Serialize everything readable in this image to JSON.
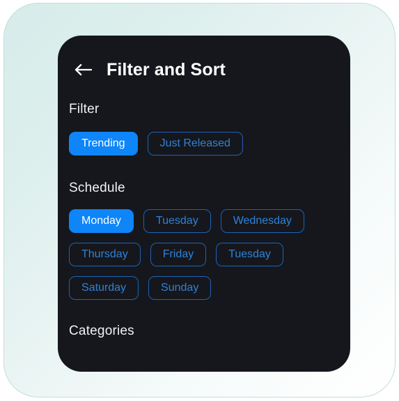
{
  "screen": {
    "background_gradient_from": "#d7ecea",
    "background_gradient_to": "#ffffff",
    "card_background": "#15171c",
    "accent_color": "#0e85f8",
    "outline_border_color": "#1c63b8",
    "outline_text_color": "#2f82d8"
  },
  "header": {
    "back_icon": "arrow-left-icon",
    "title": "Filter and Sort"
  },
  "sections": [
    {
      "key": "filter",
      "label": "Filter",
      "chips": [
        {
          "label": "Trending",
          "selected": true
        },
        {
          "label": "Just Released",
          "selected": false
        }
      ]
    },
    {
      "key": "schedule",
      "label": "Schedule",
      "chips": [
        {
          "label": "Monday",
          "selected": true
        },
        {
          "label": "Tuesday",
          "selected": false
        },
        {
          "label": "Wednesday",
          "selected": false
        },
        {
          "label": "Thursday",
          "selected": false
        },
        {
          "label": "Friday",
          "selected": false
        },
        {
          "label": "Tuesday",
          "selected": false
        },
        {
          "label": "Saturday",
          "selected": false
        },
        {
          "label": "Sunday",
          "selected": false
        }
      ]
    },
    {
      "key": "categories",
      "label": "Categories",
      "chips": []
    }
  ]
}
